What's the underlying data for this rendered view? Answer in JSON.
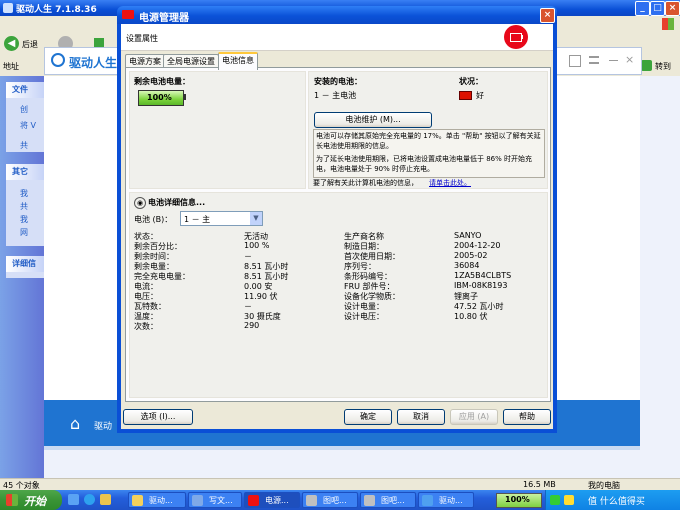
{
  "background": {
    "title": "驱动人生 7.1.8.36",
    "back_label": "后退",
    "address_label": "地址",
    "go_label": "转到",
    "app_name": "驱动人生",
    "footer_name": "驱动",
    "left_pane": {
      "file_tasks": "文件",
      "file_items": [
        "创",
        "将 V",
        "共"
      ],
      "other_places": "其它",
      "other_items": [
        "我",
        "共",
        "我",
        "网"
      ],
      "details": "详细信"
    },
    "status_left": "45 个对象",
    "status_size": "16.5 MB",
    "status_right": "我的电脑"
  },
  "taskbar": {
    "start": "开始",
    "items": [
      "驱动...",
      "写文...",
      "电源...",
      "图吧...",
      "图吧...",
      "驱动..."
    ],
    "tray_badge": "100%",
    "watermark": "值 什么值得买"
  },
  "dialog": {
    "title": "电源管理器",
    "header": "设置属性",
    "tabs": [
      "电源方案",
      "全局电源设置",
      "电池信息"
    ],
    "remaining_label": "剩余电池电量：",
    "remaining_value": "100%",
    "installed_label": "安装的电池：",
    "installed_item": "1 － 主电池",
    "status_label": "状况：",
    "status_value": "好",
    "maintain_button": "电池维护 (M)...",
    "desc1": "电池可以存储其原始完全充电量的 17%。单击 \"帮助\" 按钮以了解有关延长电池使用期限的信息。",
    "desc2": "为了延长电池使用期限，已将电池设置成电池电量低于 86% 时开始充电，电池电量处于 90% 时停止充电。",
    "link_prefix": "要了解有关此计算机电池的信息，",
    "link_text": "请单击此处。",
    "details_title": "电池详细信息...",
    "battery_select_label": "电池 (B)：",
    "battery_select_value": "1 － 主",
    "details_left": [
      [
        "状态：",
        "无活动"
      ],
      [
        "剩余百分比：",
        "100 %"
      ],
      [
        "剩余时间：",
        "－"
      ],
      [
        "剩余电量：",
        "8.51 瓦小时"
      ],
      [
        "完全充电电量：",
        "8.51 瓦小时"
      ],
      [
        "电流：",
        "0.00 安"
      ],
      [
        "电压：",
        "11.90 伏"
      ],
      [
        "瓦特数：",
        "－"
      ],
      [
        "温度：",
        "30 摄氏度"
      ],
      [
        "次数：",
        "290"
      ]
    ],
    "details_right": [
      [
        "生产商名称",
        "SANYO"
      ],
      [
        "制造日期：",
        "2004-12-20"
      ],
      [
        "首次使用日期：",
        "2005-02"
      ],
      [
        "序列号：",
        "36084"
      ],
      [
        "条形码编号：",
        "1ZA5B4CLBTS"
      ],
      [
        "FRU 部件号：",
        "IBM-08K8193"
      ],
      [
        "设备化学物质：",
        "锂离子"
      ],
      [
        "设计电量：",
        "47.52 瓦小时"
      ],
      [
        "设计电压：",
        "10.80 伏"
      ]
    ],
    "options_button": "选项 (I)...",
    "ok_button": "确定",
    "cancel_button": "取消",
    "apply_button": "应用 (A)",
    "help_button": "帮助"
  }
}
